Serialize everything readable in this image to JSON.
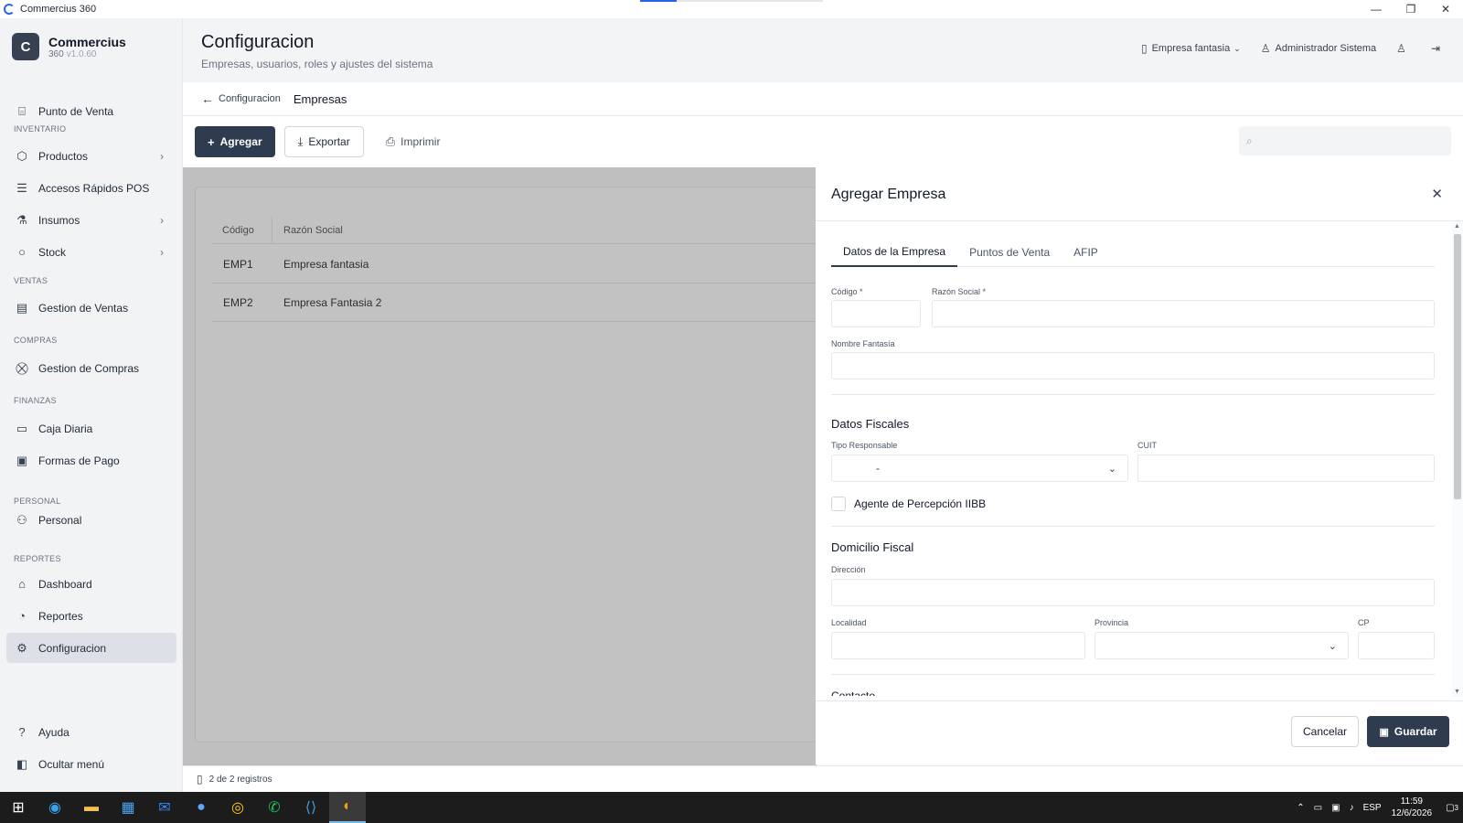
{
  "window": {
    "title": "Commercius 360",
    "controls": [
      "—",
      "❐",
      "✕"
    ]
  },
  "brand": {
    "initial": "C",
    "name": "Commercius",
    "product": "360",
    "version": "v1.0.60"
  },
  "sidebar": {
    "items": [
      {
        "label": "Punto de Venta",
        "icon": "pos-icon"
      },
      {
        "label": "Productos",
        "icon": "box-icon",
        "expandable": true
      },
      {
        "label": "Accesos Rápidos POS",
        "icon": "list-icon"
      },
      {
        "label": "Insumos",
        "icon": "flask-icon",
        "expandable": true
      },
      {
        "label": "Stock",
        "icon": "circle-icon",
        "expandable": true
      },
      {
        "label": "Gestion de Ventas",
        "icon": "receipt-icon"
      },
      {
        "label": "Gestion de Compras",
        "icon": "cart-icon"
      },
      {
        "label": "Caja Diaria",
        "icon": "cashbox-icon"
      },
      {
        "label": "Formas de Pago",
        "icon": "card-icon"
      },
      {
        "label": "Personal",
        "icon": "users-icon"
      },
      {
        "label": "Dashboard",
        "icon": "home-icon"
      },
      {
        "label": "Reportes",
        "icon": "report-icon"
      },
      {
        "label": "Configuracion",
        "icon": "gear-icon",
        "active": true
      },
      {
        "label": "Ayuda",
        "icon": "help-icon"
      },
      {
        "label": "Ocultar menú",
        "icon": "sidebar-collapse-icon"
      }
    ],
    "sections": [
      "INVENTARIO",
      "VENTAS",
      "COMPRAS",
      "FINANZAS",
      "PERSONAL",
      "REPORTES"
    ]
  },
  "header": {
    "title": "Configuracion",
    "subtitle": "Empresas, usuarios, roles y ajustes del sistema",
    "company": "Empresa fantasia",
    "user": "Administrador Sistema"
  },
  "breadcrumb": {
    "parent": "Configuracion",
    "current": "Empresas"
  },
  "toolbar": {
    "add": "Agregar",
    "export": "Exportar",
    "print": "Imprimir",
    "search_placeholder": ""
  },
  "table": {
    "columns": [
      "Código",
      "Razón Social"
    ],
    "rows": [
      {
        "code": "EMP1",
        "name": "Empresa fantasia"
      },
      {
        "code": "EMP2",
        "name": "Empresa Fantasia 2"
      }
    ]
  },
  "status": {
    "records": "2 de 2 registros"
  },
  "panel": {
    "title": "Agregar Empresa",
    "tabs": [
      "Datos de la Empresa",
      "Puntos de Venta",
      "AFIP"
    ],
    "fields": {
      "codigo": "Código *",
      "razon_social": "Razón Social *",
      "nombre_fantasia": "Nombre Fantasía",
      "tipo_responsable": "Tipo Responsable",
      "tipo_responsable_value": "-",
      "cuit": "CUIT",
      "agente": "Agente de Percepción IIBB",
      "direccion": "Dirección",
      "localidad": "Localidad",
      "provincia": "Provincia",
      "cp": "CP"
    },
    "sections": {
      "fiscal": "Datos Fiscales",
      "domicilio": "Domicilio Fiscal",
      "contacto": "Contacto"
    },
    "cancel": "Cancelar",
    "save": "Guardar"
  },
  "taskbar": {
    "lang": "ESP",
    "time": "11:59",
    "date": "12/6/2026",
    "notifications": "3"
  }
}
